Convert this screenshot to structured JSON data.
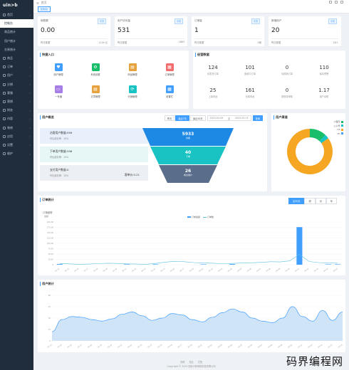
{
  "app": {
    "logo_text": "uin>b"
  },
  "sidebar": {
    "items": [
      {
        "label": "首页"
      },
      {
        "label": "控制台"
      },
      {
        "label": "商品统计"
      },
      {
        "label": "用户统计"
      },
      {
        "label": "交易统计"
      },
      {
        "label": "商品"
      },
      {
        "label": "订单"
      },
      {
        "label": "用户"
      },
      {
        "label": "分销"
      },
      {
        "label": "客服"
      },
      {
        "label": "营销"
      },
      {
        "label": "财务"
      },
      {
        "label": "内容"
      },
      {
        "label": "装修"
      },
      {
        "label": "应用"
      },
      {
        "label": "设置"
      },
      {
        "label": "维护"
      }
    ]
  },
  "topbar": {
    "breadcrumb": "首页"
  },
  "tags": {
    "active": "控制台"
  },
  "stats": [
    {
      "label": "销售额",
      "badge": "今天",
      "value": "0.00",
      "foot_label": "昨日数据",
      "foot_value": "0.00 元"
    },
    {
      "label": "用户访问量",
      "badge": "今天",
      "value": "531",
      "foot_label": "昨日数据",
      "foot_value": "1683"
    },
    {
      "label": "订单量",
      "badge": "今天",
      "value": "1",
      "foot_label": "昨日数据",
      "foot_value": "0单"
    },
    {
      "label": "新增用户",
      "badge": "今天",
      "value": "20",
      "foot_label": "昨日数据",
      "foot_value": "28人"
    }
  ],
  "quick_entry": {
    "title": "快捷入口",
    "items": [
      {
        "label": "用户管理",
        "color": "#409eff"
      },
      {
        "label": "系统设置",
        "color": "#19be6b"
      },
      {
        "label": "商品管理",
        "color": "#e6a23c"
      },
      {
        "label": "订单管理",
        "color": "#f56c6c"
      },
      {
        "label": "一号通",
        "color": "#a77de6"
      },
      {
        "label": "文章管理",
        "color": "#e6a23c"
      },
      {
        "label": "分销管理",
        "color": "#19c3c3"
      },
      {
        "label": "设置栏",
        "color": "#409eff"
      }
    ]
  },
  "stock": {
    "title": "经营数据",
    "items": [
      {
        "value": "124",
        "label": "待发货订单"
      },
      {
        "value": "101",
        "label": "退款中订单"
      },
      {
        "value": "0",
        "label": "待核销订单"
      },
      {
        "value": "110",
        "label": "库存预警"
      },
      {
        "value": "25",
        "label": "上架商品"
      },
      {
        "value": "161",
        "label": "仓库商品"
      },
      {
        "value": "0",
        "label": "提现待审核"
      },
      {
        "value": "1.17",
        "label": "用户余额"
      }
    ]
  },
  "funnel": {
    "title": "用户概览",
    "buttons": [
      "昨天",
      "最近7天",
      "最近30天"
    ],
    "active_button": "最近7天",
    "date_from": "2023-03-09",
    "date_sep": "至",
    "date_to": "2023-03-15",
    "query_label": "查询",
    "rows": [
      {
        "name": "访客用户数量:599",
        "sub": "环比增长率：10%",
        "value": "5933",
        "caption": "访客"
      },
      {
        "name": "下单用户数量:398",
        "sub": "环比增长率：10%",
        "value": "40",
        "caption": "下单"
      },
      {
        "name": "支付用户数量:0",
        "sub": "环比增长率：10%",
        "ratio": "客单价:0.21",
        "value": "26",
        "caption": "成交用户"
      }
    ]
  },
  "channel": {
    "title": "用户渠道",
    "legend": [
      "小程序",
      "公众号",
      "H5",
      "PC"
    ],
    "colors": [
      "#19be6b",
      "#19c3c3",
      "#f5a623",
      "#409eff"
    ],
    "values": [
      12,
      3,
      85,
      0
    ]
  },
  "orders": {
    "title": "订单统计",
    "ranges": [
      "近30天",
      "周",
      "月",
      "年"
    ],
    "active_range": "近30天",
    "chart_data": {
      "type": "bar",
      "title": "订单趋势",
      "ylabel": "金额",
      "legend_bar": "订单金额",
      "legend_line": "订单数",
      "ylim": [
        0,
        200
      ],
      "yticks": [
        "200.00",
        "175.00",
        "150.00",
        "125.00",
        "100.00",
        "75.00",
        "50.00",
        "25.00",
        "0"
      ],
      "categories": [
        "02-14",
        "02-15",
        "02-16",
        "02-17",
        "02-18",
        "02-19",
        "02-20",
        "02-21",
        "02-22",
        "02-23",
        "02-24",
        "02-25",
        "02-26",
        "02-27",
        "02-28",
        "03-01",
        "03-02",
        "03-03",
        "03-04",
        "03-05",
        "03-06",
        "03-07",
        "03-08",
        "03-09",
        "03-10",
        "03-11",
        "03-12",
        "03-13",
        "03-14",
        "03-15"
      ],
      "bar_values": [
        3,
        0,
        0,
        0,
        0,
        0,
        0,
        2,
        0,
        0,
        2,
        0,
        0,
        0,
        0,
        2,
        0,
        0,
        3,
        0,
        0,
        0,
        0,
        0,
        0,
        3,
        0,
        0,
        2,
        2
      ],
      "bar_highlight_index": 25,
      "bar_highlight_value": 176,
      "line_values": [
        6,
        4,
        2,
        3,
        5,
        7,
        6,
        4,
        3,
        2,
        6,
        12,
        16,
        14,
        10,
        8,
        7,
        5,
        6,
        8,
        9,
        11,
        14,
        13,
        18,
        48,
        15,
        10,
        8,
        7
      ]
    }
  },
  "users": {
    "title": "用户统计",
    "chart_data": {
      "type": "area",
      "ylim": [
        0,
        60
      ],
      "yticks": [
        "60",
        "45",
        "30",
        "15",
        "0"
      ],
      "values": [
        12,
        28,
        32,
        31,
        28,
        26,
        29,
        35,
        38,
        33,
        27,
        30,
        36,
        34,
        28,
        25,
        31,
        37,
        42,
        38,
        30,
        26,
        24,
        30,
        45,
        32,
        26,
        40,
        27,
        38
      ]
    }
  },
  "footer": {
    "links": [
      "官网",
      "社区",
      "文档"
    ],
    "copyright": "Copyright © 2023 西安众邦网络科技有限公司"
  },
  "watermark": "码界编程网"
}
